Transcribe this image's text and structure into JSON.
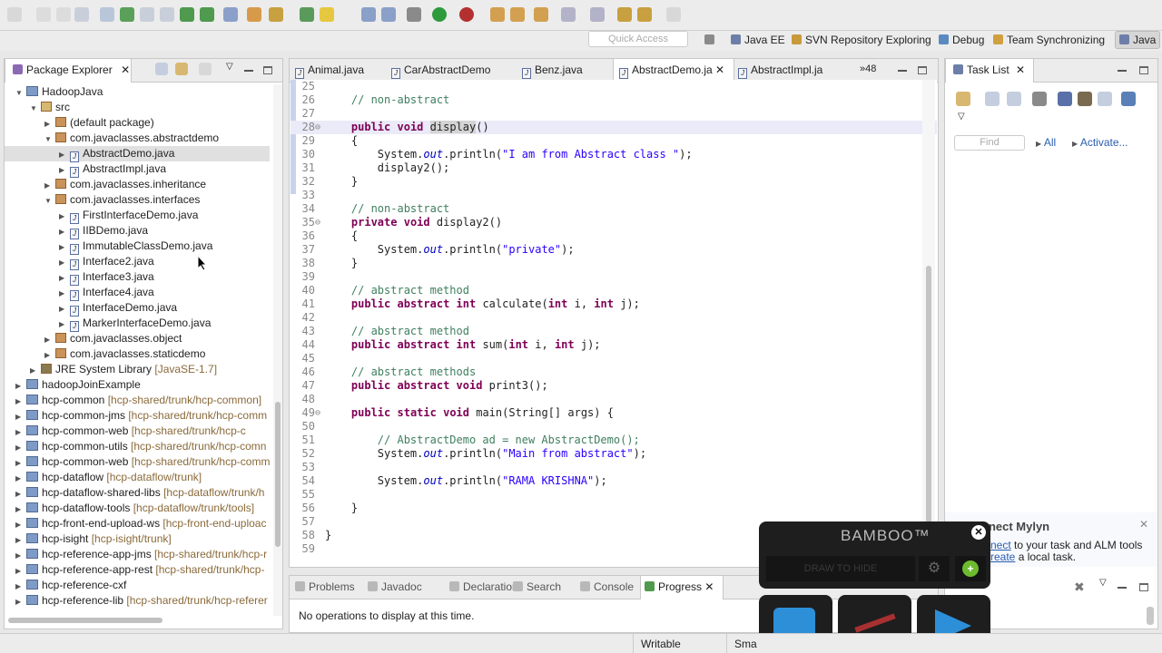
{
  "perspectives": {
    "quick_access": "Quick Access",
    "items": [
      "Java EE",
      "SVN Repository Exploring",
      "Debug",
      "Team Synchronizing",
      "Java"
    ]
  },
  "package_explorer": {
    "title": "Package Explorer",
    "items": [
      {
        "text": "HadoopJava",
        "scm": "",
        "kind": "project",
        "indent": 1,
        "tw": "▼"
      },
      {
        "text": "src",
        "scm": "",
        "kind": "folder",
        "indent": 2,
        "tw": "▼"
      },
      {
        "text": "(default package)",
        "scm": "",
        "kind": "pkg",
        "indent": 3,
        "tw": "▶"
      },
      {
        "text": "com.javaclasses.abstractdemo",
        "scm": "",
        "kind": "pkg",
        "indent": 3,
        "tw": "▼"
      },
      {
        "text": "AbstractDemo.java",
        "scm": "",
        "kind": "java",
        "indent": 4,
        "tw": "▶",
        "selected": true
      },
      {
        "text": "AbstractImpl.java",
        "scm": "",
        "kind": "java",
        "indent": 4,
        "tw": "▶"
      },
      {
        "text": "com.javaclasses.inheritance",
        "scm": "",
        "kind": "pkg",
        "indent": 3,
        "tw": "▶"
      },
      {
        "text": "com.javaclasses.interfaces",
        "scm": "",
        "kind": "pkg",
        "indent": 3,
        "tw": "▼"
      },
      {
        "text": "FirstInterfaceDemo.java",
        "scm": "",
        "kind": "java",
        "indent": 4,
        "tw": "▶"
      },
      {
        "text": "IIBDemo.java",
        "scm": "",
        "kind": "java",
        "indent": 4,
        "tw": "▶"
      },
      {
        "text": "ImmutableClassDemo.java",
        "scm": "",
        "kind": "java",
        "indent": 4,
        "tw": "▶"
      },
      {
        "text": "Interface2.java",
        "scm": "",
        "kind": "java",
        "indent": 4,
        "tw": "▶"
      },
      {
        "text": "Interface3.java",
        "scm": "",
        "kind": "java",
        "indent": 4,
        "tw": "▶"
      },
      {
        "text": "Interface4.java",
        "scm": "",
        "kind": "java",
        "indent": 4,
        "tw": "▶"
      },
      {
        "text": "InterfaceDemo.java",
        "scm": "",
        "kind": "java",
        "indent": 4,
        "tw": "▶"
      },
      {
        "text": "MarkerInterfaceDemo.java",
        "scm": "",
        "kind": "java",
        "indent": 4,
        "tw": "▶"
      },
      {
        "text": "com.javaclasses.object",
        "scm": "",
        "kind": "pkg",
        "indent": 3,
        "tw": "▶"
      },
      {
        "text": "com.javaclasses.staticdemo",
        "scm": "",
        "kind": "pkg",
        "indent": 3,
        "tw": "▶"
      },
      {
        "text": "JRE System Library",
        "scm": "[JavaSE-1.7]",
        "kind": "lib",
        "indent": 2,
        "tw": "▶"
      },
      {
        "text": "hadoopJoinExample",
        "scm": "",
        "kind": "project",
        "indent": 1,
        "tw": "▶"
      },
      {
        "text": "hcp-common",
        "scm": "[hcp-shared/trunk/hcp-common]",
        "kind": "project",
        "indent": 1,
        "tw": "▶"
      },
      {
        "text": "hcp-common-jms",
        "scm": "[hcp-shared/trunk/hcp-comm",
        "kind": "project",
        "indent": 1,
        "tw": "▶"
      },
      {
        "text": "hcp-common-web",
        "scm": "[hcp-shared/trunk/hcp-c",
        "kind": "project",
        "indent": 1,
        "tw": "▶"
      },
      {
        "text": "hcp-common-utils",
        "scm": "[hcp-shared/trunk/hcp-comn",
        "kind": "project",
        "indent": 1,
        "tw": "▶"
      },
      {
        "text": "hcp-common-web",
        "scm": "[hcp-shared/trunk/hcp-comm",
        "kind": "project",
        "indent": 1,
        "tw": "▶"
      },
      {
        "text": "hcp-dataflow",
        "scm": "[hcp-dataflow/trunk]",
        "kind": "project",
        "indent": 1,
        "tw": "▶"
      },
      {
        "text": "hcp-dataflow-shared-libs",
        "scm": "[hcp-dataflow/trunk/h",
        "kind": "project",
        "indent": 1,
        "tw": "▶"
      },
      {
        "text": "hcp-dataflow-tools",
        "scm": "[hcp-dataflow/trunk/tools]",
        "kind": "project",
        "indent": 1,
        "tw": "▶"
      },
      {
        "text": "hcp-front-end-upload-ws",
        "scm": "[hcp-front-end-uploac",
        "kind": "project",
        "indent": 1,
        "tw": "▶"
      },
      {
        "text": "hcp-isight",
        "scm": "[hcp-isight/trunk]",
        "kind": "project",
        "indent": 1,
        "tw": "▶"
      },
      {
        "text": "hcp-reference-app-jms",
        "scm": "[hcp-shared/trunk/hcp-r",
        "kind": "project",
        "indent": 1,
        "tw": "▶"
      },
      {
        "text": "hcp-reference-app-rest",
        "scm": "[hcp-shared/trunk/hcp-",
        "kind": "project",
        "indent": 1,
        "tw": "▶"
      },
      {
        "text": "hcp-reference-cxf",
        "scm": "",
        "kind": "project",
        "indent": 1,
        "tw": "▶"
      },
      {
        "text": "hcp-reference-lib",
        "scm": "[hcp-shared/trunk/hcp-referer",
        "kind": "project",
        "indent": 1,
        "tw": "▶"
      }
    ]
  },
  "editor": {
    "tabs": [
      "Animal.java",
      "CarAbstractDemo",
      "Benz.java",
      "AbstractDemo.ja",
      "AbstractImpl.ja"
    ],
    "active_tab": 3,
    "overflow": "»48",
    "lines": [
      {
        "n": "25",
        "t": ""
      },
      {
        "n": "26",
        "t": "    <c>// non-abstract</c>"
      },
      {
        "n": "27",
        "t": ""
      },
      {
        "n": "28",
        "t": "    <k>public</k> <k>void</k> display()",
        "hl": true,
        "fold": "⊖"
      },
      {
        "n": "29",
        "t": "    {"
      },
      {
        "n": "30",
        "t": "        System.<i>out</i>.println(<s>\"I am from Abstract class \"</s>);"
      },
      {
        "n": "31",
        "t": "        display2();"
      },
      {
        "n": "32",
        "t": "    }"
      },
      {
        "n": "33",
        "t": ""
      },
      {
        "n": "34",
        "t": "    <c>// non-abstract</c>"
      },
      {
        "n": "35",
        "t": "    <k>private</k> <k>void</k> display2()",
        "fold": "⊖"
      },
      {
        "n": "36",
        "t": "    {"
      },
      {
        "n": "37",
        "t": "        System.<i>out</i>.println(<s>\"private\"</s>);"
      },
      {
        "n": "38",
        "t": "    }"
      },
      {
        "n": "39",
        "t": ""
      },
      {
        "n": "40",
        "t": "    <c>// abstract method</c>"
      },
      {
        "n": "41",
        "t": "    <k>public</k> <k>abstract</k> <k>int</k> calculate(<k>int</k> i, <k>int</k> j);"
      },
      {
        "n": "42",
        "t": ""
      },
      {
        "n": "43",
        "t": "    <c>// abstract method</c>"
      },
      {
        "n": "44",
        "t": "    <k>public</k> <k>abstract</k> <k>int</k> sum(<k>int</k> i, <k>int</k> j);"
      },
      {
        "n": "45",
        "t": ""
      },
      {
        "n": "46",
        "t": "    <c>// abstract methods</c>"
      },
      {
        "n": "47",
        "t": "    <k>public</k> <k>abstract</k> <k>void</k> print3();"
      },
      {
        "n": "48",
        "t": ""
      },
      {
        "n": "49",
        "t": "    <k>public</k> <k>static</k> <k>void</k> main(String[] args) {",
        "fold": "⊖"
      },
      {
        "n": "50",
        "t": ""
      },
      {
        "n": "51",
        "t": "        <c>// AbstractDemo ad = new AbstractDemo();</c>"
      },
      {
        "n": "52",
        "t": "        System.<i>out</i>.println(<s>\"Main from abstract\"</s>);"
      },
      {
        "n": "53",
        "t": ""
      },
      {
        "n": "54",
        "t": "        System.<i>out</i>.println(<s>\"RAMA KRISHNA\"</s>);"
      },
      {
        "n": "55",
        "t": ""
      },
      {
        "n": "56",
        "t": "    }"
      },
      {
        "n": "57",
        "t": ""
      },
      {
        "n": "58",
        "t": "}"
      },
      {
        "n": "59",
        "t": ""
      }
    ]
  },
  "bottom": {
    "tabs": [
      "Problems",
      "Javadoc",
      "Declaration",
      "Search",
      "Console",
      "Progress"
    ],
    "active": 5,
    "message": "No operations to display at this time."
  },
  "task_list": {
    "title": "Task List",
    "find_placeholder": "Find",
    "all": "All",
    "activate": "Activate...",
    "mylyn_title": "nnect Mylyn",
    "mylyn_line1_link": "nect",
    "mylyn_line1": " to your task and ALM tools",
    "mylyn_line2_link": "reate",
    "mylyn_line2": " a local task."
  },
  "bamboo": {
    "logo": "BAMBOO™",
    "draw": "DRAW TO HIDE"
  },
  "status": {
    "writable": "Writable",
    "insert": "Smar"
  }
}
